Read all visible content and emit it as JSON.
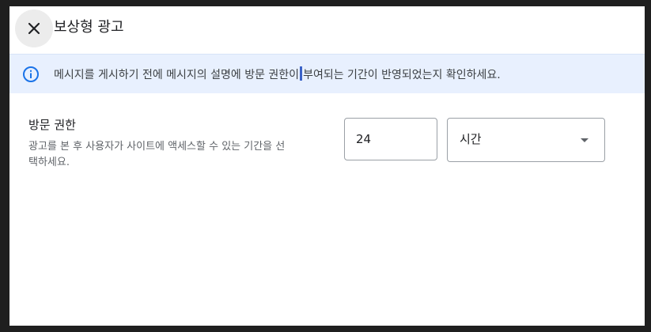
{
  "dialog": {
    "title": "보상형 광고",
    "close_icon": "close-icon"
  },
  "info_banner": {
    "icon": "info-icon",
    "text_before": "메시지를 게시하기 전에 메시지의 설명에 방문 권한이",
    "text_after": "부여되는 기간이 반영되었는지 확인하세요."
  },
  "visit_permission": {
    "label": "방문 권한",
    "description": "광고를 본 후 사용자가 사이트에 액세스할 수 있는 기간을 선택하세요.",
    "duration_value": "24",
    "unit_selected": "시간",
    "dropdown_icon": "arrow-drop-down-icon"
  },
  "colors": {
    "banner_bg": "#e8f0fe",
    "info_icon": "#1a73e8",
    "text_cursor": "#3a62c8"
  }
}
